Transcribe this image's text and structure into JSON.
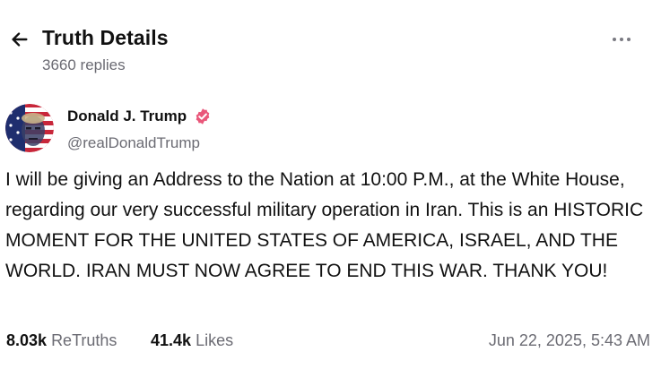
{
  "header": {
    "title": "Truth Details",
    "replies": "3660 replies",
    "back_icon": "arrow-left-icon",
    "more_icon": "more-horizontal-icon"
  },
  "post": {
    "author_name": "Donald J. Trump",
    "handle": "@realDonaldTrump",
    "verified_icon": "verified-badge-icon",
    "verified_color": "#e9577a",
    "text": "I will be giving an Address to the Nation at 10:00 P.M., at the White House, regarding our very successful military operation in Iran. This is an HISTORIC MOMENT FOR THE UNITED STATES OF AMERICA, ISRAEL, AND THE WORLD. IRAN MUST NOW AGREE TO END THIS WAR. THANK YOU!",
    "retruths_count": "8.03k",
    "retruths_label": "ReTruths",
    "likes_count": "41.4k",
    "likes_label": "Likes",
    "timestamp": "Jun 22, 2025, 5:43 AM"
  },
  "colors": {
    "text_primary": "#111111",
    "text_secondary": "#6b6b73",
    "background": "#ffffff"
  }
}
